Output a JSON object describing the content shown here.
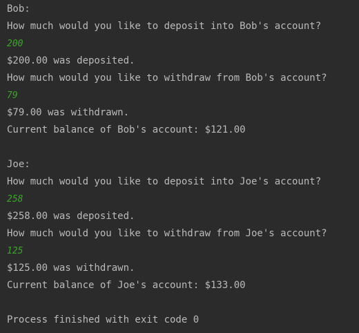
{
  "console": {
    "lines": [
      {
        "text": "Bob:",
        "type": "output"
      },
      {
        "text": "How much would you like to deposit into Bob's account?",
        "type": "output"
      },
      {
        "text": "200",
        "type": "input"
      },
      {
        "text": "$200.00 was deposited.",
        "type": "output"
      },
      {
        "text": "How much would you like to withdraw from Bob's account?",
        "type": "output"
      },
      {
        "text": "79",
        "type": "input"
      },
      {
        "text": "$79.00 was withdrawn.",
        "type": "output"
      },
      {
        "text": "Current balance of Bob's account: $121.00",
        "type": "output"
      },
      {
        "text": "",
        "type": "blank"
      },
      {
        "text": "Joe:",
        "type": "output"
      },
      {
        "text": "How much would you like to deposit into Joe's account?",
        "type": "output"
      },
      {
        "text": "258",
        "type": "input"
      },
      {
        "text": "$258.00 was deposited.",
        "type": "output"
      },
      {
        "text": "How much would you like to withdraw from Joe's account?",
        "type": "output"
      },
      {
        "text": "125",
        "type": "input"
      },
      {
        "text": "$125.00 was withdrawn.",
        "type": "output"
      },
      {
        "text": "Current balance of Joe's account: $133.00",
        "type": "output"
      },
      {
        "text": "",
        "type": "blank"
      },
      {
        "text": "Process finished with exit code 0",
        "type": "output"
      }
    ]
  },
  "colors": {
    "background": "#2b2b2b",
    "output_text": "#bbbbbb",
    "user_input_text": "#3ca52a"
  }
}
